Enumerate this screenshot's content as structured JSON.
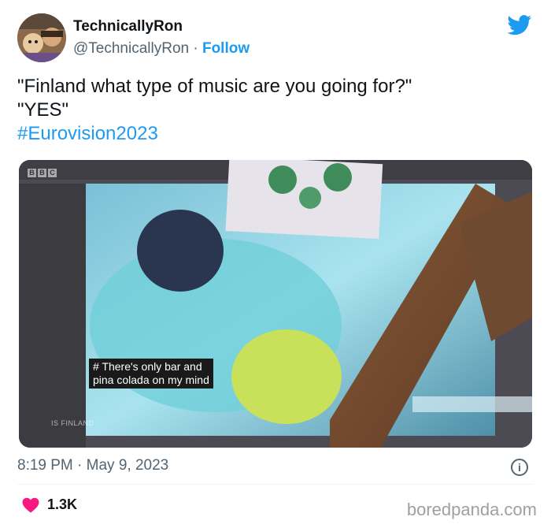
{
  "author": {
    "display_name": "TechnicallyRon",
    "handle": "@TechnicallyRon",
    "separator": " · ",
    "follow_label": "Follow"
  },
  "tweet": {
    "line1": "\"Finland what type of music are you going for?\"",
    "line2": "\"YES\"",
    "hashtag": "#Eurovision2023"
  },
  "media": {
    "caption_line1": "# There's only bar and",
    "caption_line2": "pina colada on my mind",
    "channel_logo": [
      "B",
      "B",
      "C"
    ],
    "lower_text": "IS FINLAND"
  },
  "meta": {
    "timestamp": "8:19 PM · May 9, 2023",
    "info_icon": "i"
  },
  "engagement": {
    "like_count": "1.3K"
  },
  "watermark": "boredpanda.com",
  "colors": {
    "link": "#1d9bf0",
    "heart": "#f91880",
    "secondary_text": "#536471"
  }
}
